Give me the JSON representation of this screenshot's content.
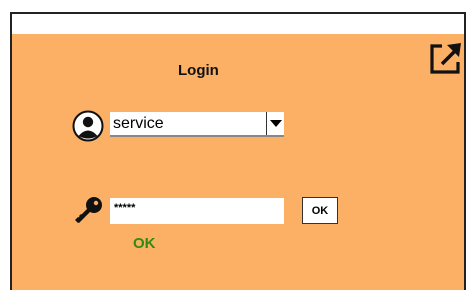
{
  "login": {
    "title": "Login",
    "user_select": {
      "value": "service"
    },
    "password": {
      "value": "*****"
    },
    "ok_button": "OK",
    "status": "OK"
  },
  "icons": {
    "user": "user-circle-icon",
    "key": "key-icon",
    "external": "open-external-icon"
  },
  "colors": {
    "panel_background": "#fbb066",
    "status_ok": "#2f8c12"
  }
}
